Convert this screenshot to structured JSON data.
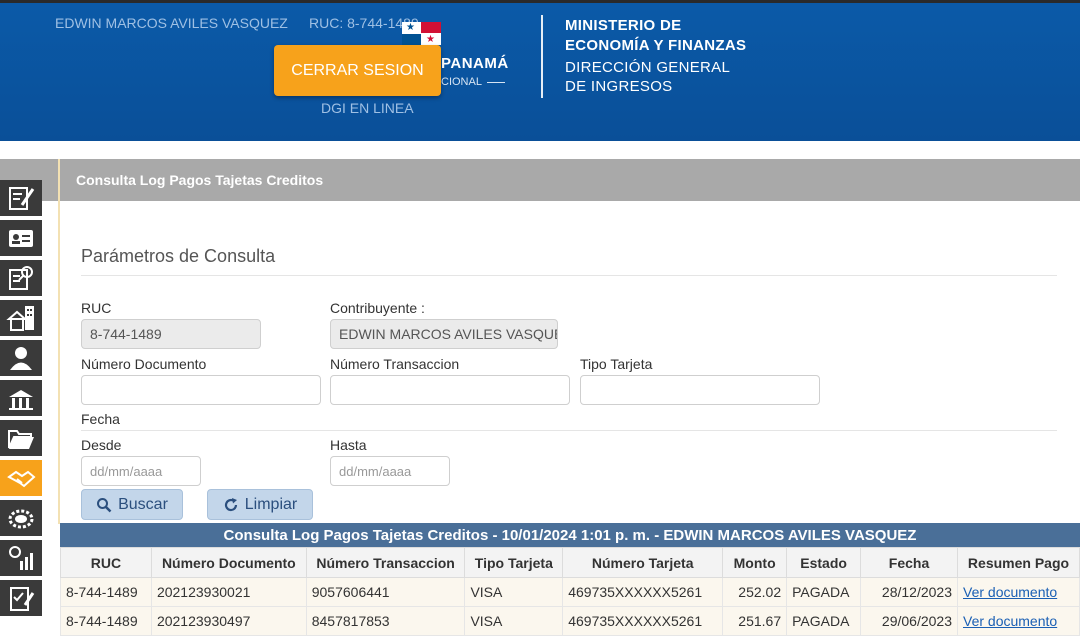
{
  "header": {
    "user_name": "EDWIN MARCOS AVILES VASQUEZ",
    "user_ruc": "RUC: 8-744-1489",
    "logout_label": "CERRAR SESION",
    "gov_name": "PANAMÁ",
    "gov_sub": "CIONAL",
    "dgi_link": "DGI EN LINEA",
    "ministry_line1": "MINISTERIO DE",
    "ministry_line2": "ECONOMÍA Y FINANZAS",
    "ministry_line3": "DIRECCIÓN GENERAL",
    "ministry_line4": "DE INGRESOS",
    "brand_color": "#0b5aa8",
    "accent_color": "#f7a21b"
  },
  "sidebar": {
    "items": [
      {
        "icon": "form-edit-icon"
      },
      {
        "icon": "id-card-icon"
      },
      {
        "icon": "document-search-icon"
      },
      {
        "icon": "buildings-icon"
      },
      {
        "icon": "person-icon"
      },
      {
        "icon": "institution-icon"
      },
      {
        "icon": "folder-open-icon"
      },
      {
        "icon": "handshake-icon",
        "active": true
      },
      {
        "icon": "coin-icon"
      },
      {
        "icon": "chart-money-icon"
      },
      {
        "icon": "checklist-icon"
      }
    ]
  },
  "page": {
    "title": "Consulta Log Pagos Tajetas Creditos"
  },
  "form": {
    "section_title": "Parámetros de Consulta",
    "ruc_label": "RUC",
    "ruc_value": "8-744-1489",
    "contribuyente_label": "Contribuyente :",
    "contribuyente_value": "EDWIN MARCOS AVILES VASQUEZ",
    "numero_documento_label": "Número Documento",
    "numero_transaccion_label": "Número Transaccion",
    "tipo_tarjeta_label": "Tipo Tarjeta",
    "fecha_label": "Fecha",
    "desde_label": "Desde",
    "desde_placeholder": "dd/mm/aaaa",
    "hasta_label": "Hasta",
    "hasta_placeholder": "dd/mm/aaaa",
    "buscar_label": "Buscar",
    "limpiar_label": "Limpiar"
  },
  "results": {
    "title": "Consulta Log Pagos Tajetas Creditos - 10/01/2024 1:01 p. m. - EDWIN MARCOS AVILES VASQUEZ",
    "columns": [
      "RUC",
      "Número Documento",
      "Número Transaccion",
      "Tipo Tarjeta",
      "Número Tarjeta",
      "Monto",
      "Estado",
      "Fecha",
      "Resumen Pago"
    ],
    "rows": [
      {
        "ruc": "8-744-1489",
        "documento": "202123930021",
        "transaccion": "9057606441",
        "tipo": "VISA",
        "tarjeta": "469735XXXXXX5261",
        "monto": "252.02",
        "estado": "PAGADA",
        "fecha": "28/12/2023",
        "resumen": "Ver documento"
      },
      {
        "ruc": "8-744-1489",
        "documento": "202123930497",
        "transaccion": "8457817853",
        "tipo": "VISA",
        "tarjeta": "469735XXXXXX5261",
        "monto": "251.67",
        "estado": "PAGADA",
        "fecha": "29/06/2023",
        "resumen": "Ver documento"
      }
    ]
  }
}
